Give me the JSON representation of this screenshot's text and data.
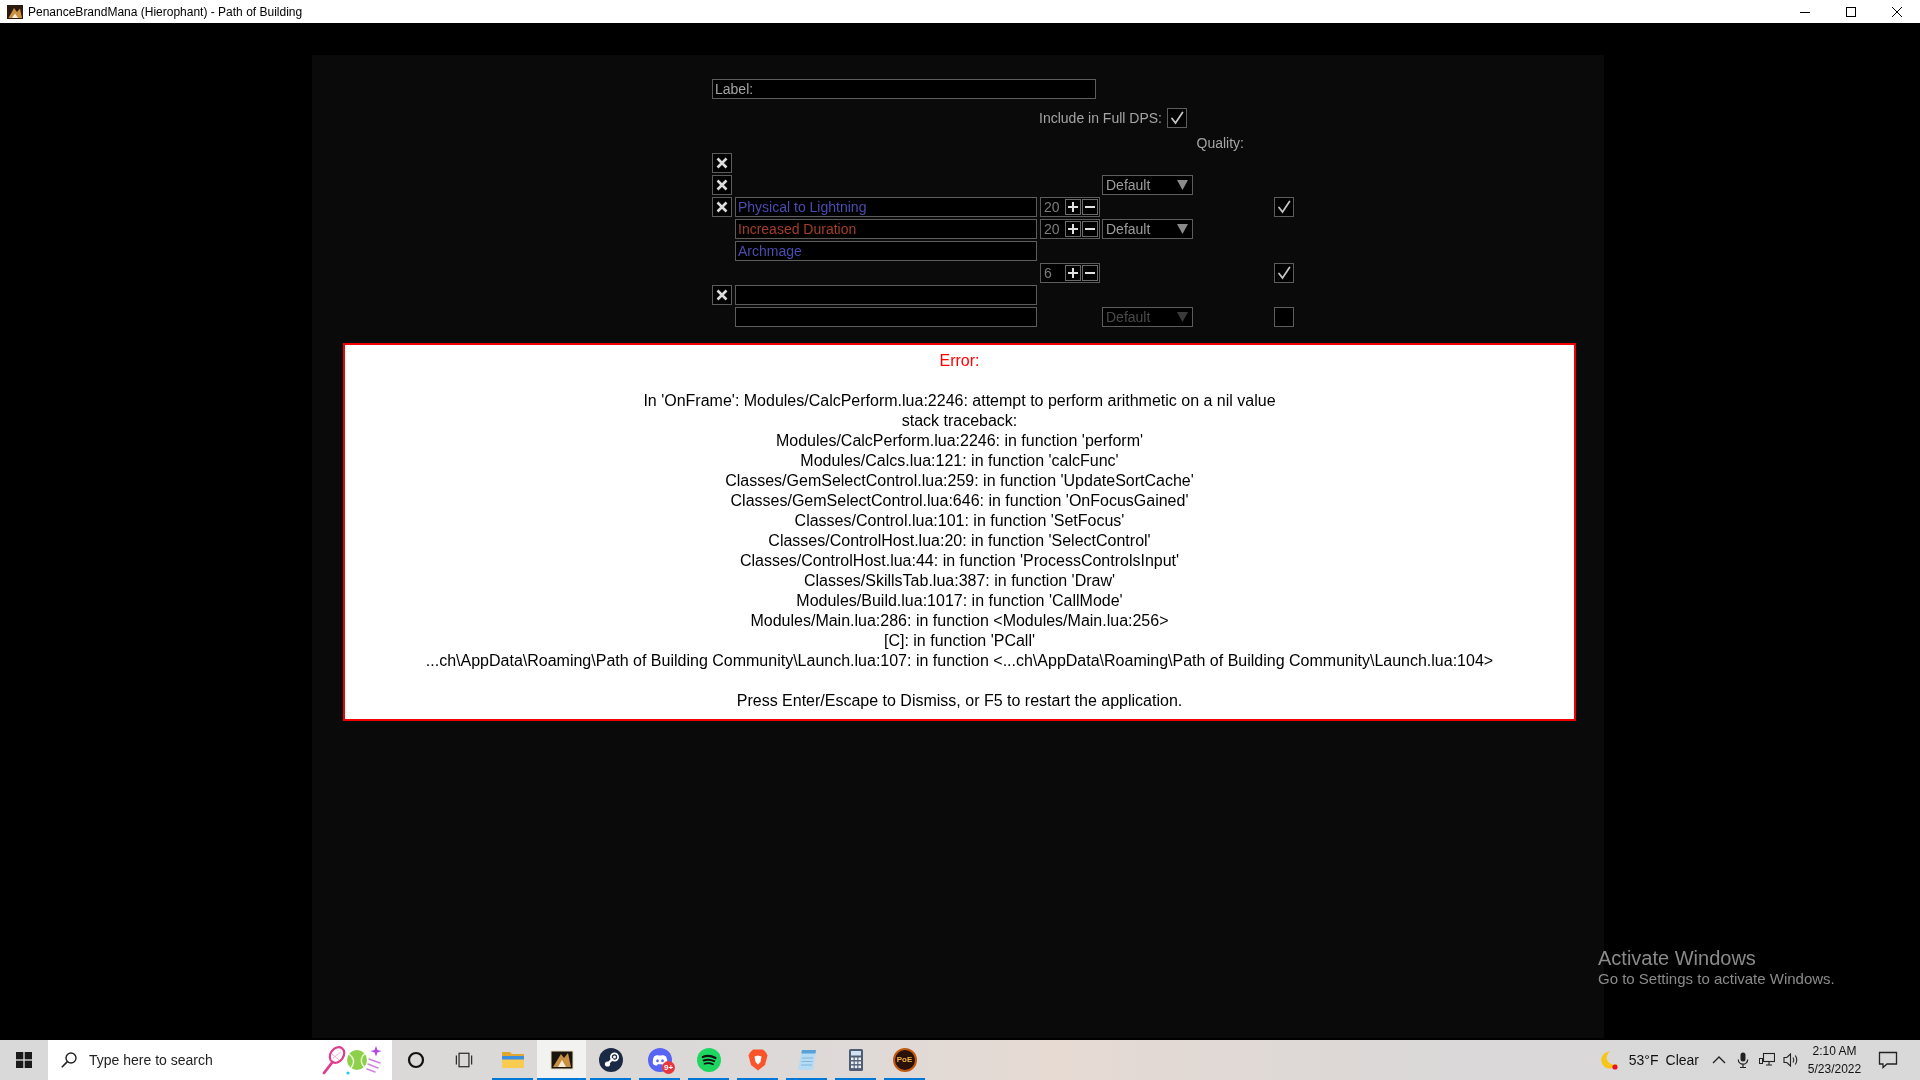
{
  "window": {
    "title": "PenanceBrandMana (Hierophant) - Path of Building"
  },
  "socket_group": {
    "label_field": {
      "prompt": "Label:"
    },
    "full_dps": {
      "label": "Include in Full DPS:",
      "checked": true
    },
    "quality_heading": "Quality:",
    "rows": [
      {
        "cells": [
          {
            "kind": "remove"
          }
        ]
      },
      {
        "cells": [
          {
            "kind": "remove"
          },
          "",
          "",
          {
            "kind": "quality",
            "value": "Default",
            "disabled": false
          }
        ]
      },
      {
        "cells": [
          {
            "kind": "remove"
          },
          {
            "kind": "gem",
            "name": "Physical to Lightning",
            "color": "#4b4bb0"
          },
          {
            "kind": "level",
            "value": "20"
          },
          "",
          {
            "kind": "toggle",
            "checked": true
          }
        ]
      },
      {
        "cells": [
          "",
          {
            "kind": "gem",
            "name": "Increased Duration",
            "color": "#a33e29"
          },
          {
            "kind": "level",
            "value": "20"
          },
          {
            "kind": "quality",
            "value": "Default",
            "disabled": false
          }
        ]
      },
      {
        "cells": [
          "",
          {
            "kind": "gem",
            "name": "Archmage",
            "color": "#4b4bb0"
          }
        ]
      },
      {
        "cells": [
          "",
          "",
          {
            "kind": "level",
            "value": "6"
          },
          "",
          {
            "kind": "toggle",
            "checked": true
          }
        ]
      },
      {
        "cells": [
          {
            "kind": "remove"
          },
          {
            "kind": "gem"
          }
        ]
      },
      {
        "cells": [
          "",
          {
            "kind": "gem"
          },
          "",
          {
            "kind": "quality",
            "value": "Default",
            "disabled": true
          },
          {
            "kind": "toggle",
            "checked": false
          }
        ]
      }
    ]
  },
  "error": {
    "title": "Error:",
    "message": "In 'OnFrame': Modules/CalcPerform.lua:2246: attempt to perform arithmetic on a nil value",
    "traceback_heading": "stack traceback:",
    "traceback": [
      "Modules/CalcPerform.lua:2246: in function 'perform'",
      "Modules/Calcs.lua:121: in function 'calcFunc'",
      "Classes/GemSelectControl.lua:259: in function 'UpdateSortCache'",
      "Classes/GemSelectControl.lua:646: in function 'OnFocusGained'",
      "Classes/Control.lua:101: in function 'SetFocus'",
      "Classes/ControlHost.lua:20: in function 'SelectControl'",
      "Classes/ControlHost.lua:44: in function 'ProcessControlsInput'",
      "Classes/SkillsTab.lua:387: in function 'Draw'",
      "Modules/Build.lua:1017: in function 'CallMode'",
      "Modules/Main.lua:286: in function <Modules/Main.lua:256>",
      "[C]: in function 'PCall'",
      "...ch\\AppData\\Roaming\\Path of Building Community\\Launch.lua:107: in function <...ch\\AppData\\Roaming\\Path of Building Community\\Launch.lua:104>"
    ],
    "hint": "Press Enter/Escape to Dismiss, or F5 to restart the application."
  },
  "activation_notice": {
    "title": "Activate Windows",
    "hint": "Go to Settings to activate Windows."
  },
  "taskbar": {
    "search": {
      "placeholder": "Type here to search"
    },
    "apps": [
      {
        "kind": "folder",
        "selected": false,
        "running": true
      },
      {
        "kind": "app-tile",
        "selected": true,
        "running": true
      },
      {
        "kind": "piston-logo",
        "selected": false,
        "running": true
      },
      {
        "kind": "controller-logo",
        "selected": false,
        "running": true,
        "badge": "9+"
      },
      {
        "kind": "wave-logo",
        "selected": false,
        "running": true
      },
      {
        "kind": "lion-logo",
        "selected": false,
        "running": true
      },
      {
        "kind": "notepad",
        "selected": false,
        "running": true
      },
      {
        "kind": "calculator",
        "selected": false,
        "running": true
      },
      {
        "kind": "lettered-emblem",
        "selected": false,
        "running": true,
        "logo_text": "PoE"
      }
    ],
    "weather": {
      "temperature": "53°F",
      "condition": "Clear"
    },
    "time": "2:10 AM",
    "date": "5/23/2022"
  }
}
